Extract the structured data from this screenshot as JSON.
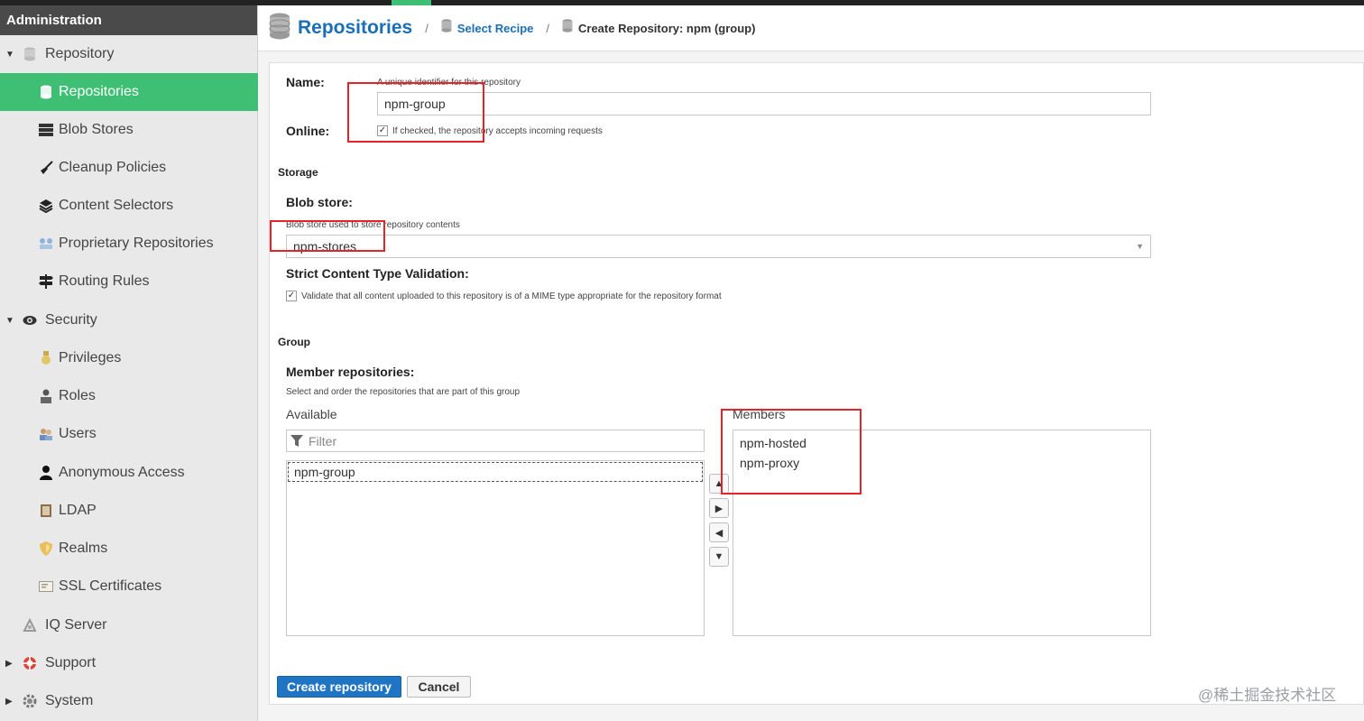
{
  "sidebar": {
    "header": "Administration",
    "items": [
      {
        "label": "Repository",
        "icon": "database-icon"
      },
      {
        "label": "Repositories",
        "icon": "database-icon"
      },
      {
        "label": "Blob Stores",
        "icon": "server-icon"
      },
      {
        "label": "Cleanup Policies",
        "icon": "broom-icon"
      },
      {
        "label": "Content Selectors",
        "icon": "layers-icon"
      },
      {
        "label": "Proprietary Repositories",
        "icon": "proprietary-icon"
      },
      {
        "label": "Routing Rules",
        "icon": "signpost-icon"
      },
      {
        "label": "Security",
        "icon": "eye-icon"
      },
      {
        "label": "Privileges",
        "icon": "medal-icon"
      },
      {
        "label": "Roles",
        "icon": "role-icon"
      },
      {
        "label": "Users",
        "icon": "users-icon"
      },
      {
        "label": "Anonymous Access",
        "icon": "user-icon"
      },
      {
        "label": "LDAP",
        "icon": "book-icon"
      },
      {
        "label": "Realms",
        "icon": "shield-icon"
      },
      {
        "label": "SSL Certificates",
        "icon": "certificate-icon"
      },
      {
        "label": "IQ Server",
        "icon": "iq-icon"
      },
      {
        "label": "Support",
        "icon": "lifebuoy-icon"
      },
      {
        "label": "System",
        "icon": "gear-icon"
      }
    ]
  },
  "breadcrumb": {
    "title": "Repositories",
    "sep": "/",
    "step2": "Select Recipe",
    "current": "Create Repository: npm (group)"
  },
  "form": {
    "name_label": "Name:",
    "name_hint": "A unique identifier for this repository",
    "name_value": "npm-group",
    "online_label": "Online:",
    "online_hint": "If checked, the repository accepts incoming requests",
    "check_mark": "✓",
    "storage_title": "Storage",
    "blob_label": "Blob store:",
    "blob_hint": "Blob store used to store repository contents",
    "blob_value": "npm-stores",
    "strict_label": "Strict Content Type Validation:",
    "strict_hint": "Validate that all content uploaded to this repository is of a MIME type appropriate for the repository format",
    "group_title": "Group",
    "members_label": "Member repositories:",
    "members_hint": "Select and order the repositories that are part of this group",
    "available_label": "Available",
    "filter_placeholder": "Filter",
    "available_items": [
      "npm-group"
    ],
    "members_col_label": "Members",
    "member_items": [
      "npm-hosted",
      "npm-proxy"
    ]
  },
  "buttons": {
    "create": "Create repository",
    "cancel": "Cancel"
  },
  "watermark": "@稀土掘金技术社区",
  "colors": {
    "accent_green": "#3fbf74",
    "link_blue": "#1a6fb5",
    "primary_button": "#1f74c4",
    "annotation_red": "#e3252b"
  }
}
